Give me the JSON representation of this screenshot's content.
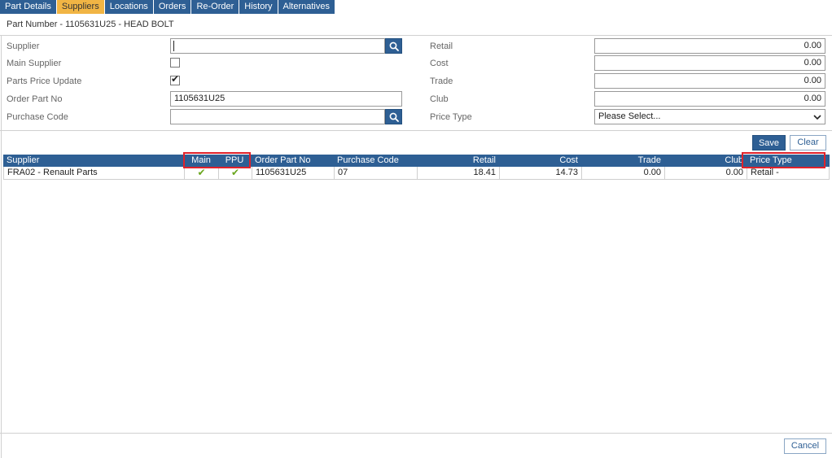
{
  "tabs": [
    {
      "label": "Part Details",
      "active": false
    },
    {
      "label": "Suppliers",
      "active": true
    },
    {
      "label": "Locations",
      "active": false
    },
    {
      "label": "Orders",
      "active": false
    },
    {
      "label": "Re-Order",
      "active": false
    },
    {
      "label": "History",
      "active": false
    },
    {
      "label": "Alternatives",
      "active": false
    }
  ],
  "header": {
    "title": "Part Number - 1105631U25 - HEAD BOLT"
  },
  "form": {
    "left": {
      "supplier_label": "Supplier",
      "supplier_value": "",
      "main_supplier_label": "Main Supplier",
      "main_supplier_checked": false,
      "parts_price_update_label": "Parts Price Update",
      "parts_price_update_checked": true,
      "order_part_no_label": "Order Part No",
      "order_part_no_value": "1105631U25",
      "purchase_code_label": "Purchase Code",
      "purchase_code_value": ""
    },
    "right": {
      "retail_label": "Retail",
      "retail_value": "0.00",
      "cost_label": "Cost",
      "cost_value": "0.00",
      "trade_label": "Trade",
      "trade_value": "0.00",
      "club_label": "Club",
      "club_value": "0.00",
      "price_type_label": "Price Type",
      "price_type_value": "Please Select..."
    }
  },
  "buttons": {
    "save": "Save",
    "clear": "Clear",
    "cancel": "Cancel"
  },
  "grid": {
    "columns": [
      "Supplier",
      "Main",
      "PPU",
      "Order Part No",
      "Purchase Code",
      "Retail",
      "Cost",
      "Trade",
      "Club",
      "Price Type"
    ],
    "rows": [
      {
        "supplier": "FRA02 - Renault Parts",
        "main": "✔",
        "ppu": "✔",
        "order_part_no": "1105631U25",
        "purchase_code": "07",
        "retail": "18.41",
        "cost": "14.73",
        "trade": "0.00",
        "club": "0.00",
        "price_type": "Retail -"
      }
    ]
  },
  "colors": {
    "primary": "#2e5f94",
    "active_tab": "#f1b544",
    "check": "#6aa61e",
    "highlight": "#e0222a"
  },
  "icons": {
    "search": "search-icon",
    "dropdown": "chevron-down-icon",
    "check": "check-icon"
  }
}
